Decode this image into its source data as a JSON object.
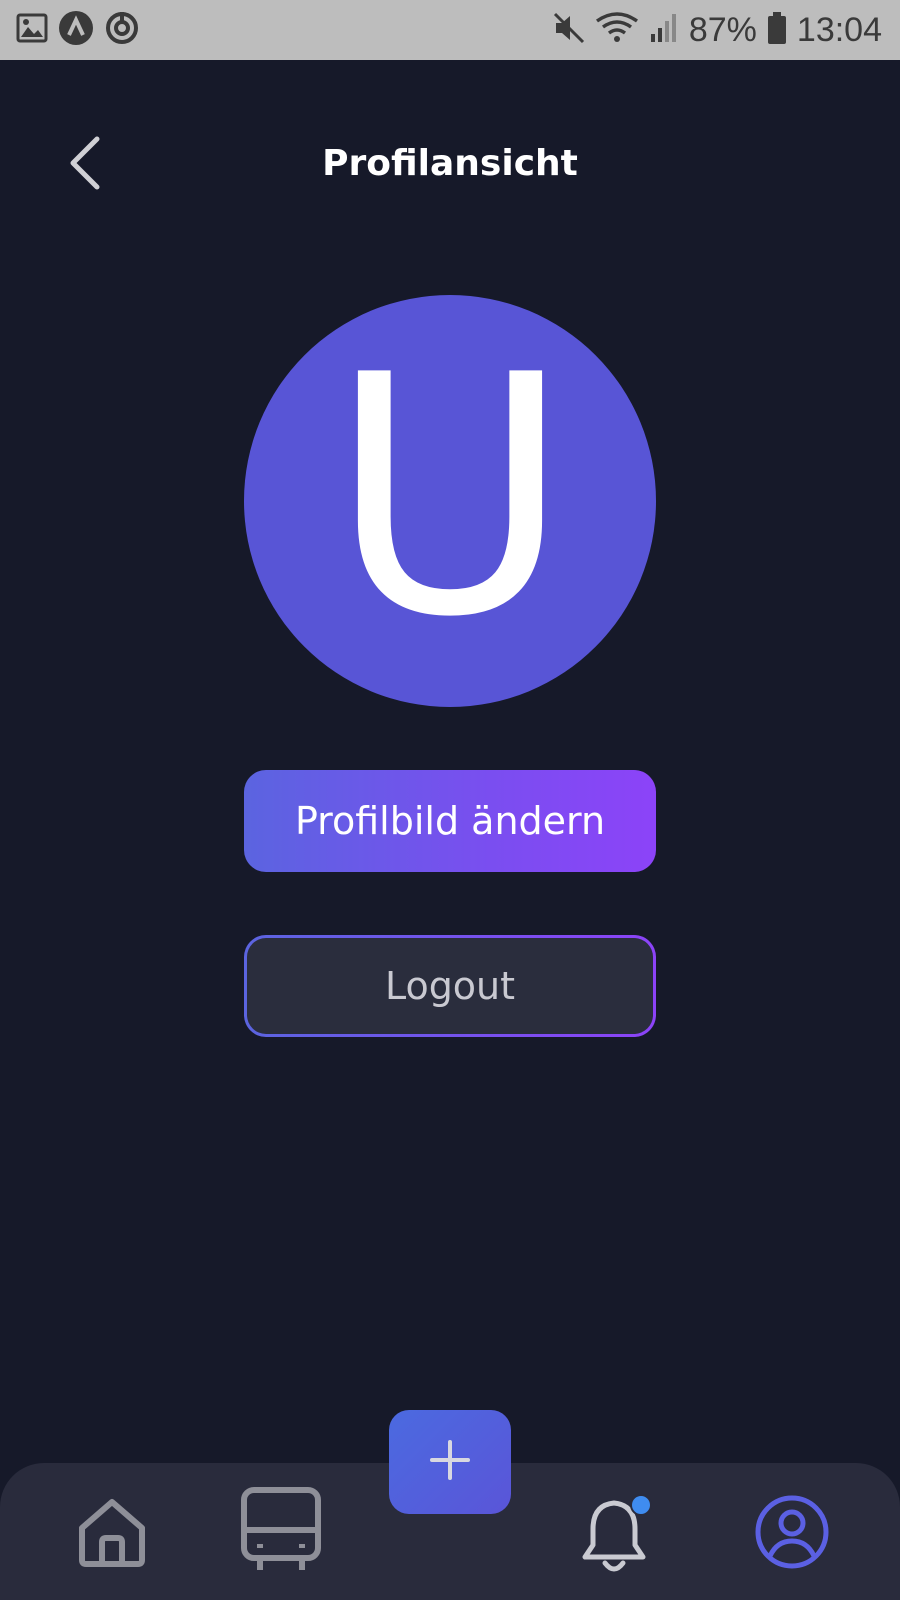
{
  "status_bar": {
    "battery_percent": "87%",
    "time": "13:04",
    "icons": [
      "image-icon",
      "app-icon",
      "sync-icon",
      "mute-icon",
      "wifi-icon",
      "signal-icon",
      "battery-icon"
    ]
  },
  "header": {
    "title": "Profilansicht",
    "back_icon": "chevron-left-icon"
  },
  "profile": {
    "avatar_letter": "U",
    "avatar_color": "#5855d6"
  },
  "actions": {
    "change_picture_label": "Profilbild ändern",
    "logout_label": "Logout"
  },
  "bottom_nav": {
    "items": [
      {
        "icon": "home-icon"
      },
      {
        "icon": "bus-icon"
      },
      {
        "icon": "plus-icon"
      },
      {
        "icon": "bell-icon"
      },
      {
        "icon": "profile-icon"
      }
    ],
    "active_color": "#5b60e3",
    "notification_dot_color": "#3f8cf0"
  },
  "colors": {
    "background": "#161929",
    "nav_background": "#292b3c",
    "gradient_start": "#5b64e0",
    "gradient_end": "#8c43f8"
  }
}
